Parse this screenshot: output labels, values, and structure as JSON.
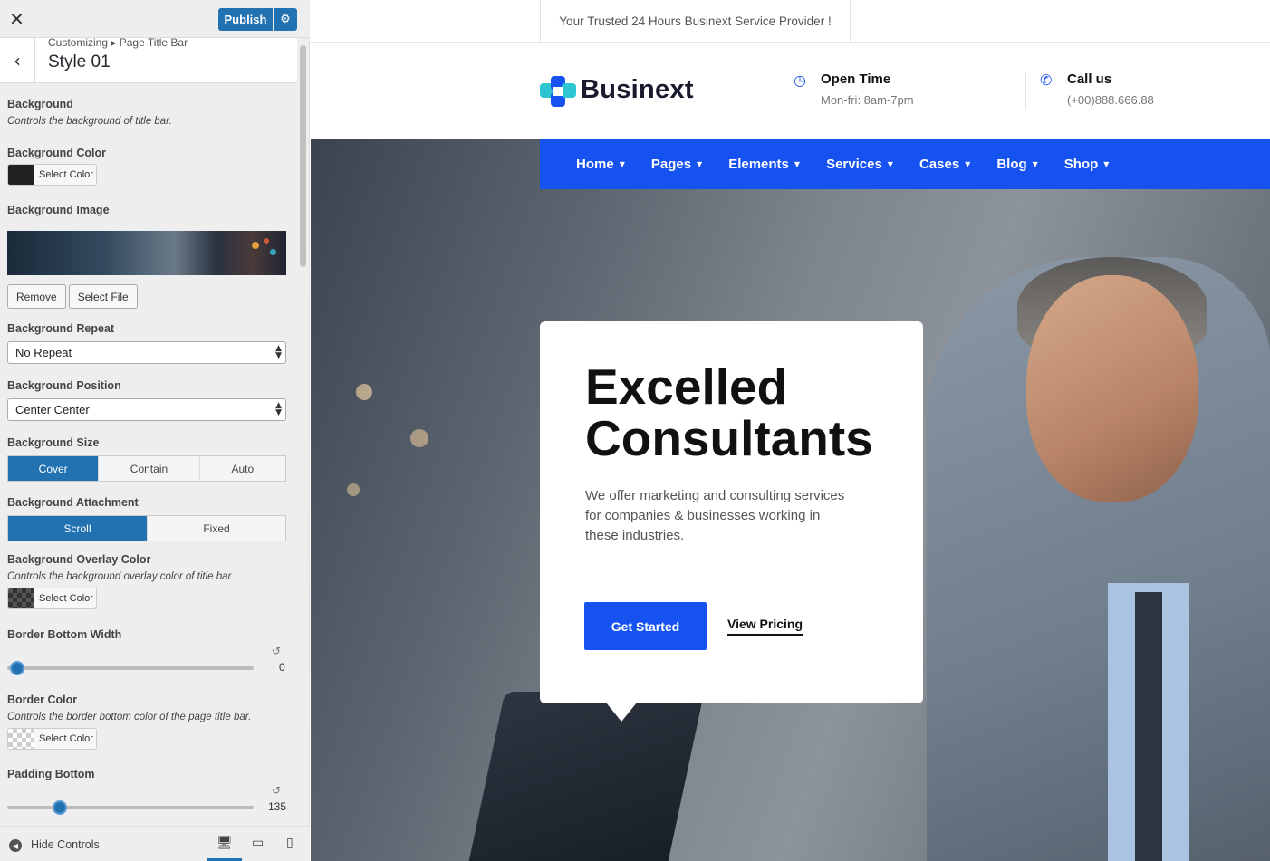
{
  "customizer": {
    "publish_label": "Publish",
    "breadcrumb": "Customizing ▸ Page Title Bar",
    "section_title": "Style 01",
    "background": {
      "label": "Background",
      "desc": "Controls the background of title bar."
    },
    "background_color": {
      "label": "Background Color",
      "button": "Select Color",
      "swatch": "#222222"
    },
    "background_image": {
      "label": "Background Image",
      "remove": "Remove",
      "select_file": "Select File"
    },
    "background_repeat": {
      "label": "Background Repeat",
      "value": "No Repeat"
    },
    "background_position": {
      "label": "Background Position",
      "value": "Center Center"
    },
    "background_size": {
      "label": "Background Size",
      "options": [
        "Cover",
        "Contain",
        "Auto"
      ],
      "selected": "Cover"
    },
    "background_attachment": {
      "label": "Background Attachment",
      "options": [
        "Scroll",
        "Fixed"
      ],
      "selected": "Scroll"
    },
    "overlay_color": {
      "label": "Background Overlay Color",
      "desc": "Controls the background overlay color of title bar.",
      "button": "Select Color"
    },
    "border_bottom_width": {
      "label": "Border Bottom Width",
      "value": "0"
    },
    "border_color": {
      "label": "Border Color",
      "desc": "Controls the border bottom color of the page title bar.",
      "button": "Select Color"
    },
    "padding_bottom": {
      "label": "Padding Bottom",
      "value": "135"
    },
    "footer": {
      "hide_controls": "Hide Controls"
    }
  },
  "site": {
    "topbar_text": "Your Trusted 24 Hours Businext Service Provider !",
    "logo_text": "Businext",
    "open_time": {
      "title": "Open Time",
      "sub": "Mon-fri: 8am-7pm"
    },
    "call_us": {
      "title": "Call us",
      "sub": "(+00)888.666.88"
    },
    "nav": [
      "Home",
      "Pages",
      "Elements",
      "Services",
      "Cases",
      "Blog",
      "Shop"
    ],
    "hero": {
      "title_line1": "Excelled",
      "title_line2": "Consultants",
      "subtitle": "We offer marketing and consulting services for companies & businesses working in these industries.",
      "primary_cta": "Get Started",
      "secondary_cta": "View Pricing"
    },
    "accent_color": "#1652f0"
  }
}
